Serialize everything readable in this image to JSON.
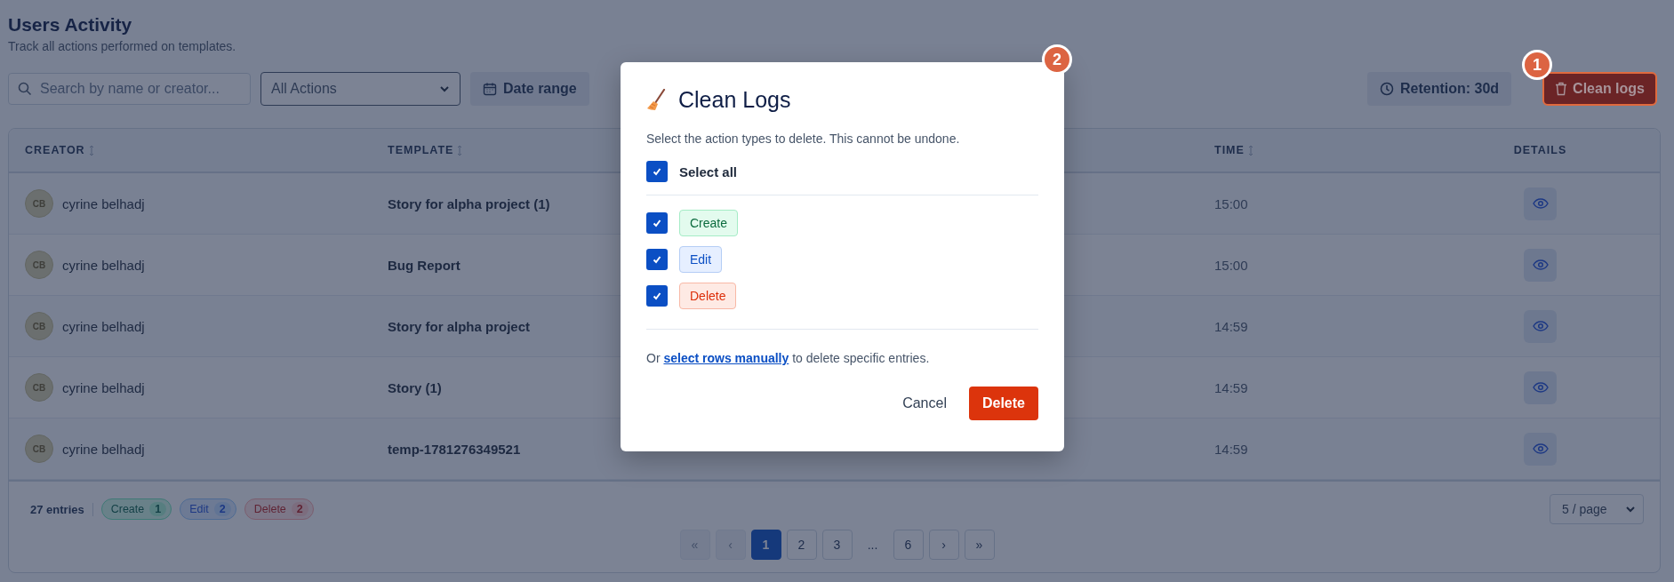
{
  "page": {
    "title": "Users Activity",
    "subtitle": "Track all actions performed on templates."
  },
  "toolbar": {
    "search": {
      "placeholder": "Search by name or creator..."
    },
    "action_filter": {
      "value": "All Actions"
    },
    "date_range": "Date range",
    "retention": "Retention: 30d",
    "clean_logs": "Clean logs"
  },
  "table": {
    "columns": [
      {
        "label": "CREATOR",
        "sortable": true
      },
      {
        "label": "TEMPLATE",
        "sortable": true
      },
      {
        "label": "TIME",
        "sortable": true
      },
      {
        "label": "DETAILS",
        "sortable": false
      }
    ],
    "rows": [
      {
        "initials": "CB",
        "creator": "cyrine belhadj",
        "template": "Story for alpha project (1)",
        "time": "15:00"
      },
      {
        "initials": "CB",
        "creator": "cyrine belhadj",
        "template": "Bug Report",
        "time": "15:00"
      },
      {
        "initials": "CB",
        "creator": "cyrine belhadj",
        "template": "Story for alpha project",
        "time": "14:59"
      },
      {
        "initials": "CB",
        "creator": "cyrine belhadj",
        "template": "Story (1)",
        "time": "14:59"
      },
      {
        "initials": "CB",
        "creator": "cyrine belhadj",
        "template": "temp-1781276349521",
        "time": "14:59"
      }
    ]
  },
  "footer": {
    "entries": "27 entries",
    "counts": [
      {
        "kind": "create",
        "label": "Create",
        "count": "1"
      },
      {
        "kind": "edit",
        "label": "Edit",
        "count": "2"
      },
      {
        "kind": "delete",
        "label": "Delete",
        "count": "2"
      }
    ],
    "per_page": "5 / page",
    "pagination": [
      {
        "label": "«",
        "disabled": true,
        "selected": false
      },
      {
        "label": "‹",
        "disabled": true,
        "selected": false
      },
      {
        "label": "1",
        "disabled": false,
        "selected": true
      },
      {
        "label": "2",
        "disabled": false,
        "selected": false
      },
      {
        "label": "3",
        "disabled": false,
        "selected": false
      },
      {
        "label": "...",
        "kind": "ellipsis"
      },
      {
        "label": "6",
        "disabled": false,
        "selected": false
      },
      {
        "label": "›",
        "disabled": false,
        "selected": false
      },
      {
        "label": "»",
        "disabled": false,
        "selected": false
      }
    ]
  },
  "modal": {
    "title": "Clean Logs",
    "description": "Select the action types to delete. This cannot be undone.",
    "select_all": {
      "label": "Select all",
      "checked": true
    },
    "options": [
      {
        "kind": "create",
        "label": "Create",
        "checked": true
      },
      {
        "kind": "edit",
        "label": "Edit",
        "checked": true
      },
      {
        "kind": "delete",
        "label": "Delete",
        "checked": true
      }
    ],
    "note": {
      "before": "Or",
      "link": "select rows manually",
      "after": "to delete specific entries."
    },
    "cancel": "Cancel",
    "confirm": "Delete"
  },
  "markers": [
    {
      "label": "2"
    },
    {
      "label": "1"
    }
  ]
}
